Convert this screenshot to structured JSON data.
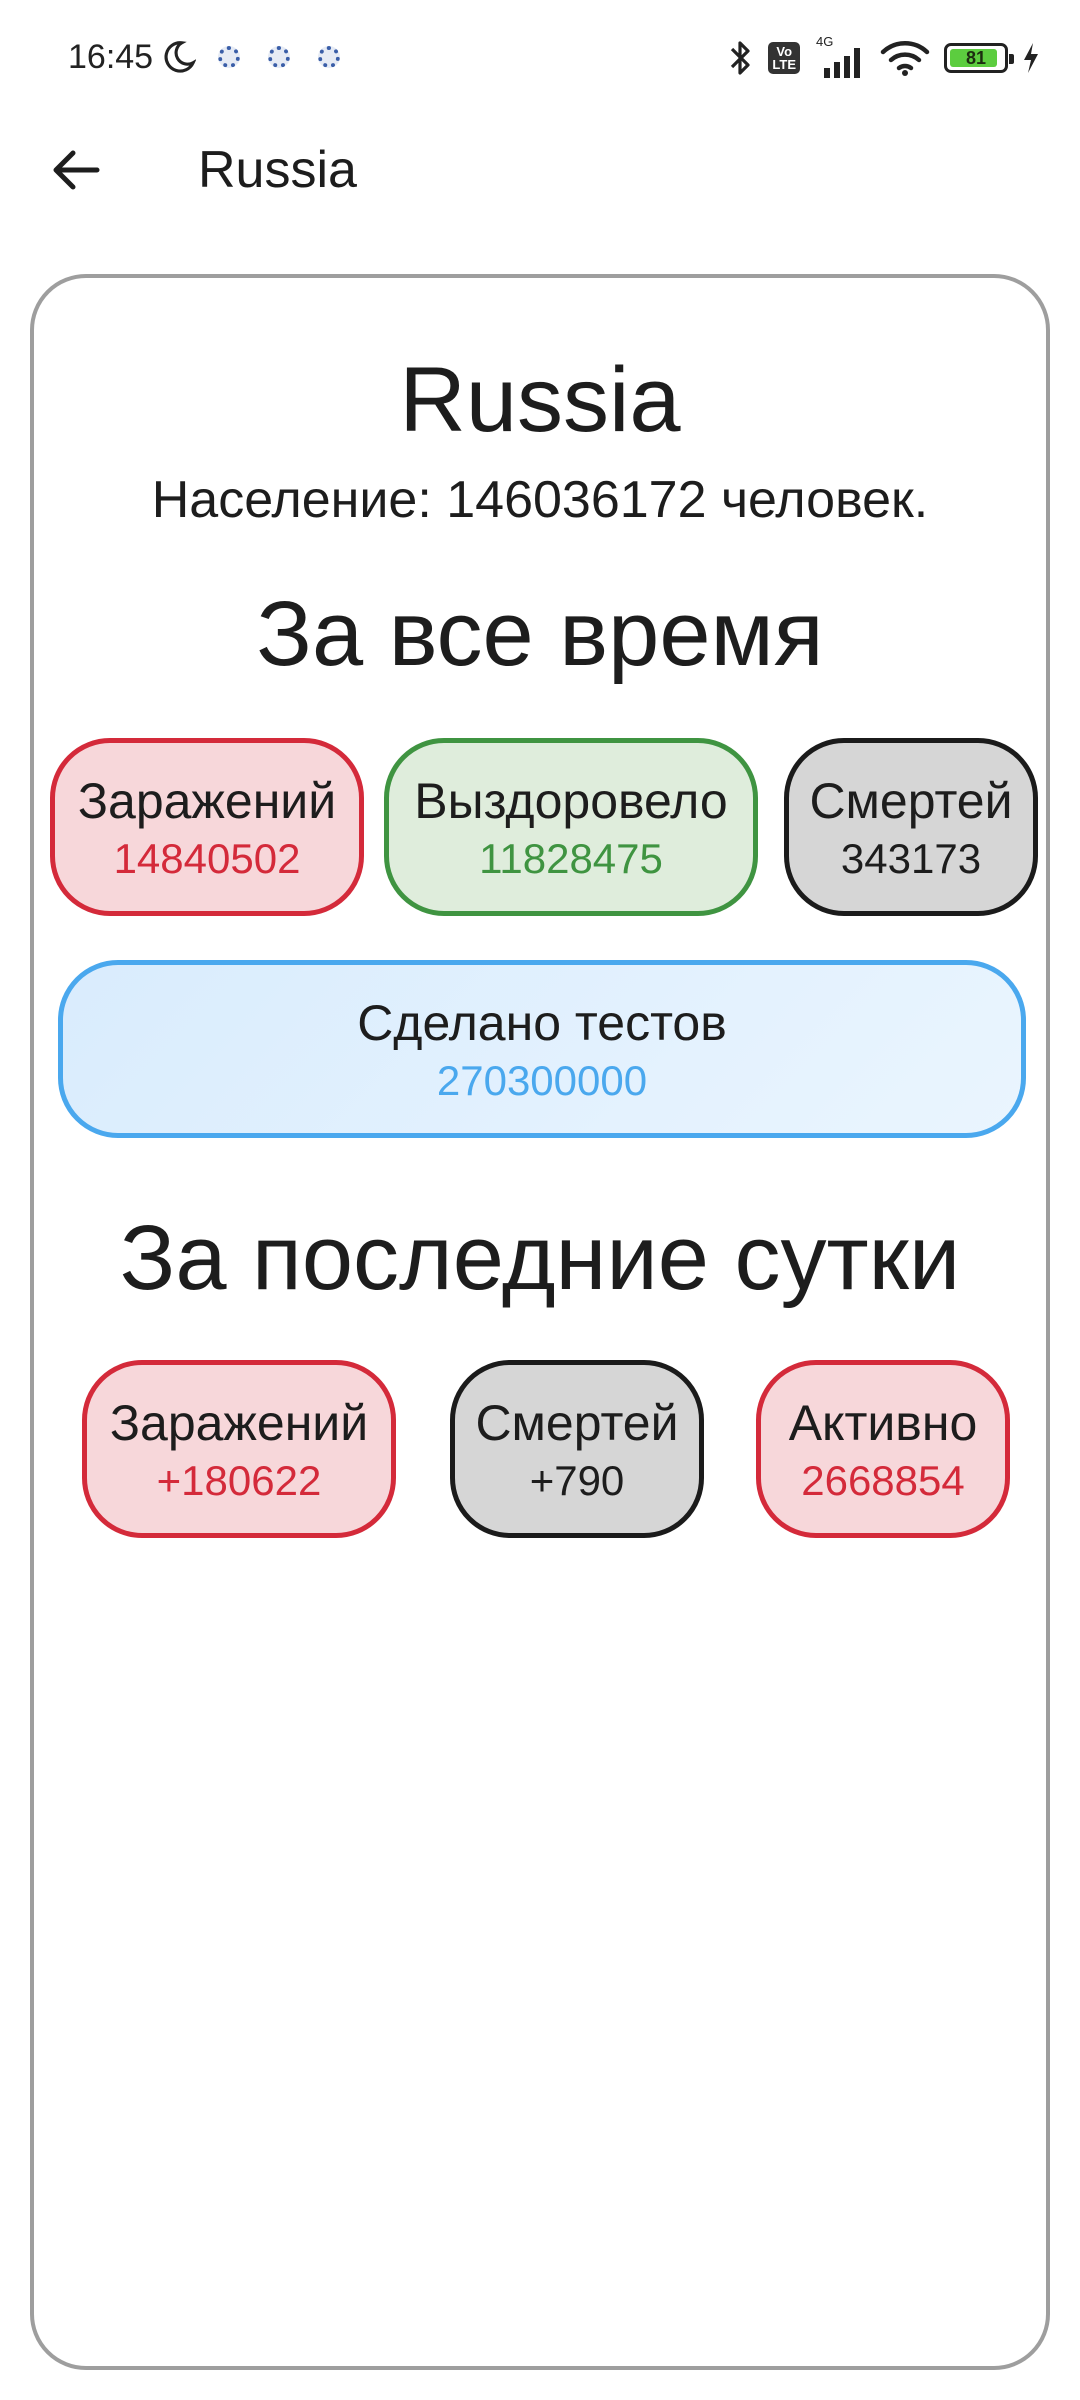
{
  "status_bar": {
    "time": "16:45",
    "network": "4G",
    "battery": "81",
    "icons": [
      "moon-icon",
      "gear-icon",
      "gear-icon",
      "gear-icon",
      "bluetooth-icon",
      "volte-icon",
      "signal-icon",
      "wifi-icon",
      "battery-icon",
      "charging-icon"
    ]
  },
  "app_bar": {
    "title": "Russia",
    "back_icon": "arrow-left-icon"
  },
  "card": {
    "country": "Russia",
    "population": "Население: 146036172 человек.",
    "all_time": {
      "title": "За все время",
      "infected": {
        "label": "Заражений",
        "value": "14840502"
      },
      "recovered": {
        "label": "Выздоровело",
        "value": "11828475"
      },
      "deaths": {
        "label": "Смертей",
        "value": "343173"
      },
      "tests": {
        "label": "Сделано тестов",
        "value": "270300000"
      }
    },
    "last_day": {
      "title": "За последние сутки",
      "infected": {
        "label": "Заражений",
        "value": "+180622"
      },
      "deaths": {
        "label": "Смертей",
        "value": "+790"
      },
      "active": {
        "label": "Активно",
        "value": "2668854"
      }
    }
  },
  "colors": {
    "red": "#d42a3a",
    "green": "#3f9441",
    "blue": "#4aa8ee",
    "dark": "#1b1b1b"
  }
}
